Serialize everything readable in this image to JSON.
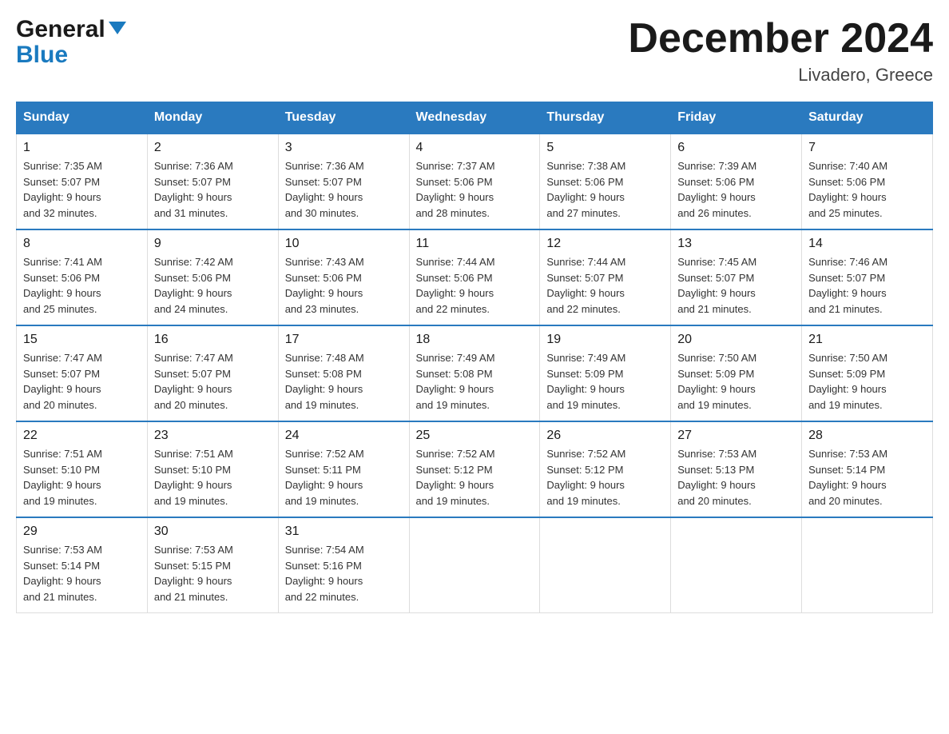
{
  "header": {
    "logo_general": "General",
    "logo_blue": "Blue",
    "month_title": "December 2024",
    "location": "Livadero, Greece"
  },
  "weekdays": [
    "Sunday",
    "Monday",
    "Tuesday",
    "Wednesday",
    "Thursday",
    "Friday",
    "Saturday"
  ],
  "weeks": [
    [
      {
        "day": "1",
        "sunrise": "7:35 AM",
        "sunset": "5:07 PM",
        "daylight": "9 hours and 32 minutes."
      },
      {
        "day": "2",
        "sunrise": "7:36 AM",
        "sunset": "5:07 PM",
        "daylight": "9 hours and 31 minutes."
      },
      {
        "day": "3",
        "sunrise": "7:36 AM",
        "sunset": "5:07 PM",
        "daylight": "9 hours and 30 minutes."
      },
      {
        "day": "4",
        "sunrise": "7:37 AM",
        "sunset": "5:06 PM",
        "daylight": "9 hours and 28 minutes."
      },
      {
        "day": "5",
        "sunrise": "7:38 AM",
        "sunset": "5:06 PM",
        "daylight": "9 hours and 27 minutes."
      },
      {
        "day": "6",
        "sunrise": "7:39 AM",
        "sunset": "5:06 PM",
        "daylight": "9 hours and 26 minutes."
      },
      {
        "day": "7",
        "sunrise": "7:40 AM",
        "sunset": "5:06 PM",
        "daylight": "9 hours and 25 minutes."
      }
    ],
    [
      {
        "day": "8",
        "sunrise": "7:41 AM",
        "sunset": "5:06 PM",
        "daylight": "9 hours and 25 minutes."
      },
      {
        "day": "9",
        "sunrise": "7:42 AM",
        "sunset": "5:06 PM",
        "daylight": "9 hours and 24 minutes."
      },
      {
        "day": "10",
        "sunrise": "7:43 AM",
        "sunset": "5:06 PM",
        "daylight": "9 hours and 23 minutes."
      },
      {
        "day": "11",
        "sunrise": "7:44 AM",
        "sunset": "5:06 PM",
        "daylight": "9 hours and 22 minutes."
      },
      {
        "day": "12",
        "sunrise": "7:44 AM",
        "sunset": "5:07 PM",
        "daylight": "9 hours and 22 minutes."
      },
      {
        "day": "13",
        "sunrise": "7:45 AM",
        "sunset": "5:07 PM",
        "daylight": "9 hours and 21 minutes."
      },
      {
        "day": "14",
        "sunrise": "7:46 AM",
        "sunset": "5:07 PM",
        "daylight": "9 hours and 21 minutes."
      }
    ],
    [
      {
        "day": "15",
        "sunrise": "7:47 AM",
        "sunset": "5:07 PM",
        "daylight": "9 hours and 20 minutes."
      },
      {
        "day": "16",
        "sunrise": "7:47 AM",
        "sunset": "5:07 PM",
        "daylight": "9 hours and 20 minutes."
      },
      {
        "day": "17",
        "sunrise": "7:48 AM",
        "sunset": "5:08 PM",
        "daylight": "9 hours and 19 minutes."
      },
      {
        "day": "18",
        "sunrise": "7:49 AM",
        "sunset": "5:08 PM",
        "daylight": "9 hours and 19 minutes."
      },
      {
        "day": "19",
        "sunrise": "7:49 AM",
        "sunset": "5:09 PM",
        "daylight": "9 hours and 19 minutes."
      },
      {
        "day": "20",
        "sunrise": "7:50 AM",
        "sunset": "5:09 PM",
        "daylight": "9 hours and 19 minutes."
      },
      {
        "day": "21",
        "sunrise": "7:50 AM",
        "sunset": "5:09 PM",
        "daylight": "9 hours and 19 minutes."
      }
    ],
    [
      {
        "day": "22",
        "sunrise": "7:51 AM",
        "sunset": "5:10 PM",
        "daylight": "9 hours and 19 minutes."
      },
      {
        "day": "23",
        "sunrise": "7:51 AM",
        "sunset": "5:10 PM",
        "daylight": "9 hours and 19 minutes."
      },
      {
        "day": "24",
        "sunrise": "7:52 AM",
        "sunset": "5:11 PM",
        "daylight": "9 hours and 19 minutes."
      },
      {
        "day": "25",
        "sunrise": "7:52 AM",
        "sunset": "5:12 PM",
        "daylight": "9 hours and 19 minutes."
      },
      {
        "day": "26",
        "sunrise": "7:52 AM",
        "sunset": "5:12 PM",
        "daylight": "9 hours and 19 minutes."
      },
      {
        "day": "27",
        "sunrise": "7:53 AM",
        "sunset": "5:13 PM",
        "daylight": "9 hours and 20 minutes."
      },
      {
        "day": "28",
        "sunrise": "7:53 AM",
        "sunset": "5:14 PM",
        "daylight": "9 hours and 20 minutes."
      }
    ],
    [
      {
        "day": "29",
        "sunrise": "7:53 AM",
        "sunset": "5:14 PM",
        "daylight": "9 hours and 21 minutes."
      },
      {
        "day": "30",
        "sunrise": "7:53 AM",
        "sunset": "5:15 PM",
        "daylight": "9 hours and 21 minutes."
      },
      {
        "day": "31",
        "sunrise": "7:54 AM",
        "sunset": "5:16 PM",
        "daylight": "9 hours and 22 minutes."
      },
      null,
      null,
      null,
      null
    ]
  ]
}
